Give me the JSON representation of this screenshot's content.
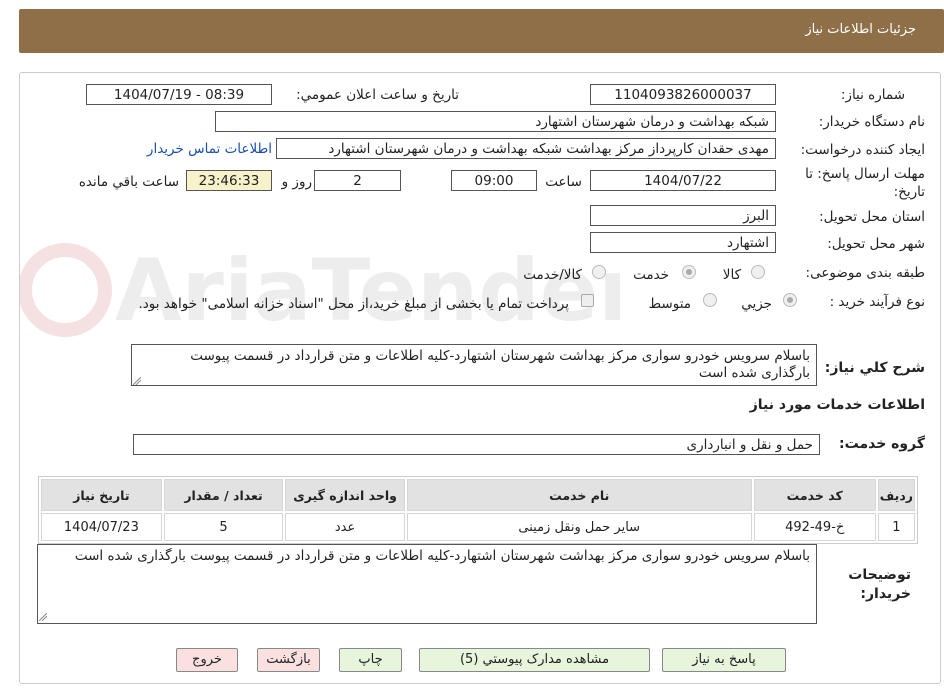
{
  "header": {
    "title": "جزئیات اطلاعات نیاز"
  },
  "watermark": {
    "text": "AriaTender.neT"
  },
  "fields": {
    "need_number_label": "شماره نیاز:",
    "need_number": "1104093826000037",
    "announce_label": "تاریخ و ساعت اعلان عمومي:",
    "announce_value": "1404/07/19 - 08:39",
    "buyer_org_label": "نام دستگاه خریدار:",
    "buyer_org": "شبکه بهداشت و درمان شهرستان اشتهارد",
    "requester_label": "ایجاد کننده درخواست:",
    "requester": "مهدی حقدان کارپرداز مرکز بهداشت شبکه بهداشت و درمان شهرستان اشتهارد",
    "contact_link": "اطلاعات تماس خریدار",
    "deadline_label_1": "مهلت ارسال پاسخ: تا",
    "deadline_label_2": "تاریخ:",
    "deadline_date": "1404/07/22",
    "time_label": "ساعت",
    "deadline_time": "09:00",
    "days": "2",
    "days_label": "روز و",
    "remaining": "23:46:33",
    "remaining_label": "ساعت باقي مانده",
    "province_label": "استان محل تحویل:",
    "province": "البرز",
    "city_label": "شهر محل تحویل:",
    "city": "اشتهارد",
    "category_label": "طبقه بندی موضوعی:",
    "category_options": [
      "کالا",
      "خدمت",
      "کالا/خدمت"
    ],
    "process_label": "نوع فرآیند خرید :",
    "process_options": [
      "جزيي",
      "متوسط"
    ],
    "payment_note": "پرداخت تمام یا بخشی از مبلغ خرید،از محل \"اسناد خزانه اسلامی\" خواهد بود."
  },
  "description": {
    "label": "شرح کلي نیاز:",
    "text": "باسلام سرویس خودرو سواری مرکز بهداشت شهرستان اشتهارد-کلیه اطلاعات و متن قرارداد در قسمت پیوست بارگذاری شده است"
  },
  "services": {
    "section_title": "اطلاعات خدمات مورد نیاز",
    "group_label": "گروه خدمت:",
    "group_value": "حمل و نقل و انبارداری",
    "columns": [
      "ردیف",
      "کد خدمت",
      "نام خدمت",
      "واحد اندازه گیری",
      "تعداد / مقدار",
      "تاریخ نیاز"
    ],
    "rows": [
      [
        "1",
        "خ-49-492",
        "سایر حمل ونقل زمینی",
        "عدد",
        "5",
        "1404/07/23"
      ]
    ]
  },
  "buyer_notes": {
    "label_1": "توضیحات",
    "label_2": "خریدار:",
    "text": "باسلام سرویس خودرو سواری مرکز بهداشت شهرستان اشتهارد-کلیه اطلاعات و متن قرارداد در قسمت پیوست بارگذاری شده است"
  },
  "buttons": {
    "reply": "پاسخ به نیاز",
    "attachments": "مشاهده مدارک پیوستي (5)",
    "print": "چاپ",
    "back": "بازگشت",
    "exit": "خروج"
  }
}
